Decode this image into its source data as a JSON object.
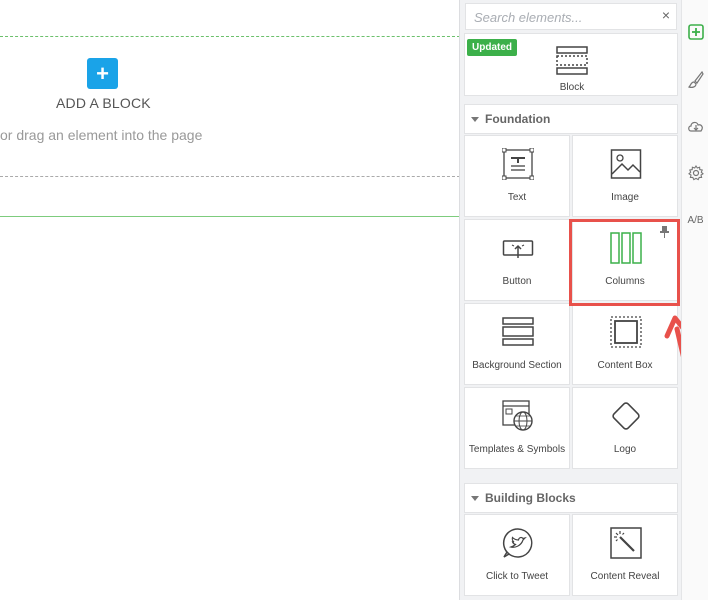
{
  "canvas": {
    "add_block_label": "ADD A BLOCK",
    "add_block_button": "+",
    "drag_hint": "or drag an element into the page"
  },
  "panel": {
    "search": {
      "placeholder": "Search elements...",
      "clear_symbol": "×"
    },
    "top_tile": {
      "badge": "Updated",
      "label": "Block"
    },
    "sections": [
      {
        "title": "Foundation",
        "items": [
          {
            "label": "Text",
            "icon": "text-icon"
          },
          {
            "label": "Image",
            "icon": "image-icon"
          },
          {
            "label": "Button",
            "icon": "button-icon"
          },
          {
            "label": "Columns",
            "icon": "columns-icon",
            "highlighted": true,
            "pinned": true
          },
          {
            "label": "Background Section",
            "icon": "background-section-icon"
          },
          {
            "label": "Content Box",
            "icon": "content-box-icon"
          },
          {
            "label": "Templates & Symbols",
            "icon": "templates-symbols-icon"
          },
          {
            "label": "Logo",
            "icon": "logo-icon"
          }
        ]
      },
      {
        "title": "Building Blocks",
        "items": [
          {
            "label": "Click to Tweet",
            "icon": "twitter-icon"
          },
          {
            "label": "Content Reveal",
            "icon": "magic-wand-icon"
          }
        ]
      }
    ]
  },
  "rail": {
    "buttons": [
      "add-icon",
      "brush-icon",
      "cloud-download-icon",
      "gear-icon",
      "ab-test-icon"
    ],
    "ab_label": "A/B"
  },
  "colors": {
    "accent_blue": "#1aa3e8",
    "accent_green": "#3cb04a",
    "highlight_red": "#e8514b"
  }
}
